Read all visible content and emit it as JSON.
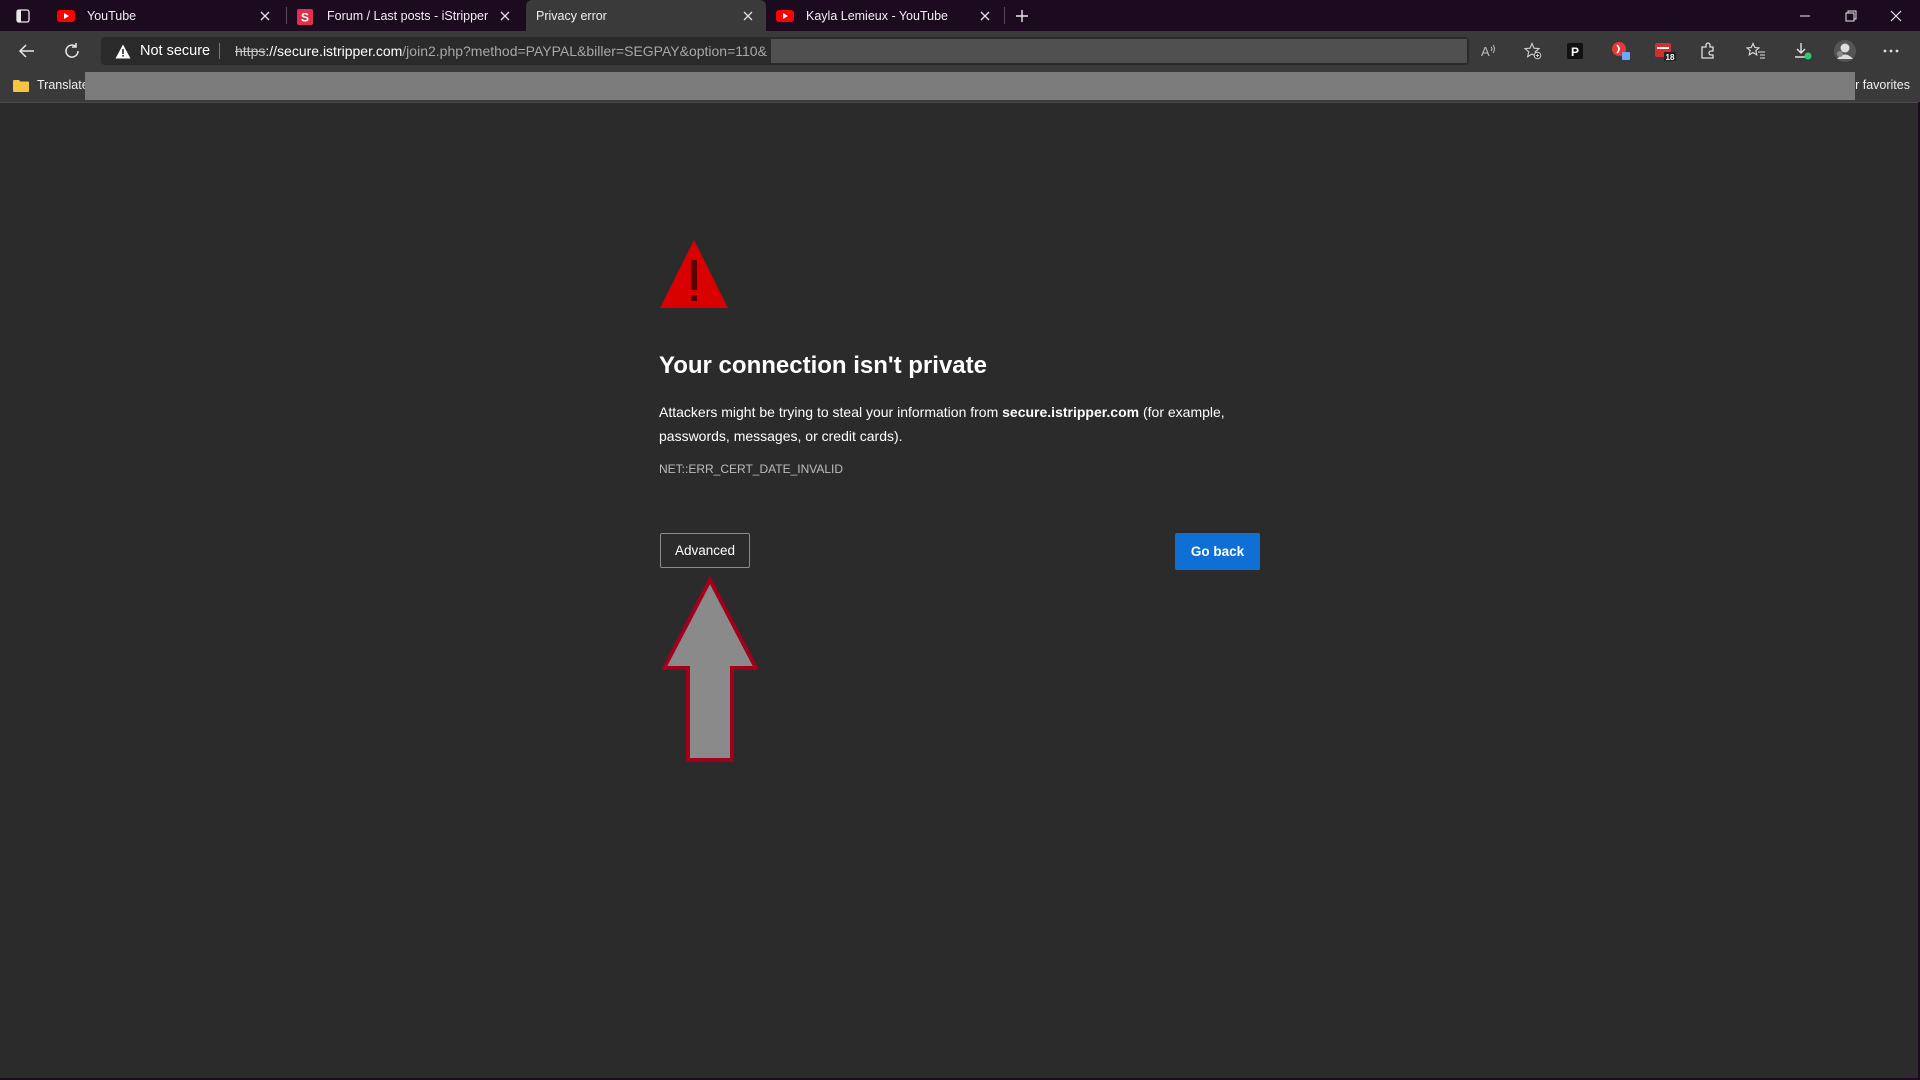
{
  "tabs": [
    {
      "title": "YouTube",
      "favicon": "youtube-icon",
      "active": false
    },
    {
      "title": "Forum / Last posts - iStripper",
      "favicon": "istripper-icon",
      "active": false
    },
    {
      "title": "Privacy error",
      "favicon": "",
      "active": true
    },
    {
      "title": "Kayla Lemieux - YouTube",
      "favicon": "youtube-icon",
      "active": false
    }
  ],
  "toolbar": {
    "security_label": "Not secure",
    "url_scheme": "https",
    "url_host": "://secure.istripper.com",
    "url_path": "/join2.php?method=PAYPAL&biller=SEGPAY&option=110&"
  },
  "favorites": {
    "folder_label": "Translate",
    "other_label": "r favorites"
  },
  "error_page": {
    "title": "Your connection isn't private",
    "desc_before": "Attackers might be trying to steal your information from ",
    "desc_host": "secure.istripper.com",
    "desc_after": " (for example, passwords, messages, or credit cards).",
    "error_code": "NET::ERR_CERT_DATE_INVALID",
    "advanced_label": "Advanced",
    "go_back_label": "Go back"
  },
  "colors": {
    "accent_blue": "#0f6fd4",
    "warning_red": "#d90000",
    "tabstrip_bg": "#1c0b1f",
    "page_bg": "#2b2b2b"
  },
  "annotation": {
    "icon": "up-arrow-annotation",
    "color": "#8a8a8a",
    "outline": "#a0001c"
  }
}
